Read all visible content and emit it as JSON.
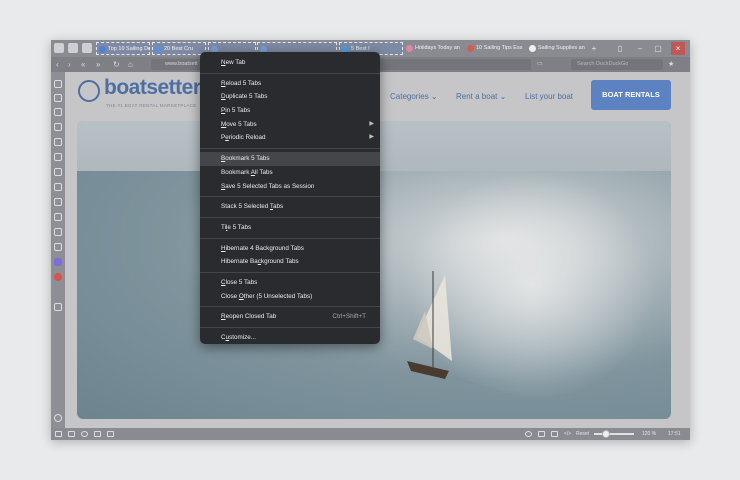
{
  "tabs": [
    {
      "label": "Top 10 Sailing Dest",
      "selected": true,
      "color": "#4f7fd6"
    },
    {
      "label": "20 Best Cru",
      "selected": true,
      "color": "#5b8fd9"
    },
    {
      "label": "",
      "selected": true,
      "color": "#7a9fd6"
    },
    {
      "label": "",
      "selected": true,
      "color": "#7a9fd6"
    },
    {
      "label": "5 Best I",
      "selected": true,
      "color": "#4f9de0"
    },
    {
      "label": "Holidays Today an",
      "selected": false,
      "color": "#d98aa0"
    },
    {
      "label": "10 Sailing Tips Ess",
      "selected": false,
      "color": "#d95a4f"
    },
    {
      "label": "Sailing Supplies an",
      "selected": false,
      "color": "#f0f0f0"
    }
  ],
  "address": {
    "url": "www.boatsett",
    "search_placeholder": "Search DuckDuckGo"
  },
  "site": {
    "logo": "boatsetter",
    "tagline": "THE #1 BOAT RENTAL MARKETPLACE",
    "menu": [
      "Categories",
      "Rent a boat",
      "List your boat"
    ],
    "cta": "BOAT RENTALS"
  },
  "status": {
    "reset": "Reset",
    "zoom": "120 %",
    "time": "17:51"
  },
  "context_menu": {
    "groups": [
      [
        {
          "label": "New Tab",
          "u": "N"
        }
      ],
      [
        {
          "label": "Reload 5 Tabs",
          "u": "R"
        },
        {
          "label": "Duplicate 5 Tabs",
          "u": "D"
        },
        {
          "label": "Pin 5 Tabs",
          "u": "P"
        },
        {
          "label": "Move 5 Tabs",
          "u": "M",
          "submenu": true
        },
        {
          "label": "Periodic Reload",
          "u": "e",
          "submenu": true
        }
      ],
      [
        {
          "label": "Bookmark 5 Tabs",
          "u": "B",
          "highlight": true
        },
        {
          "label": "Bookmark All Tabs",
          "u": "A"
        },
        {
          "label": "Save 5 Selected Tabs as Session",
          "u": "S"
        }
      ],
      [
        {
          "label": "Stack 5 Selected Tabs",
          "u": "T"
        }
      ],
      [
        {
          "label": "Tile 5 Tabs",
          "u": "l"
        }
      ],
      [
        {
          "label": "Hibernate 4 Background Tabs",
          "u": "H"
        },
        {
          "label": "Hibernate Background Tabs",
          "u": "c"
        }
      ],
      [
        {
          "label": "Close 5 Tabs",
          "u": "C"
        },
        {
          "label": "Close Other (5 Unselected Tabs)",
          "u": "O"
        }
      ],
      [
        {
          "label": "Reopen Closed Tab",
          "u": "R",
          "shortcut": "Ctrl+Shift+T"
        }
      ],
      [
        {
          "label": "Customize...",
          "u": "u"
        }
      ]
    ]
  }
}
